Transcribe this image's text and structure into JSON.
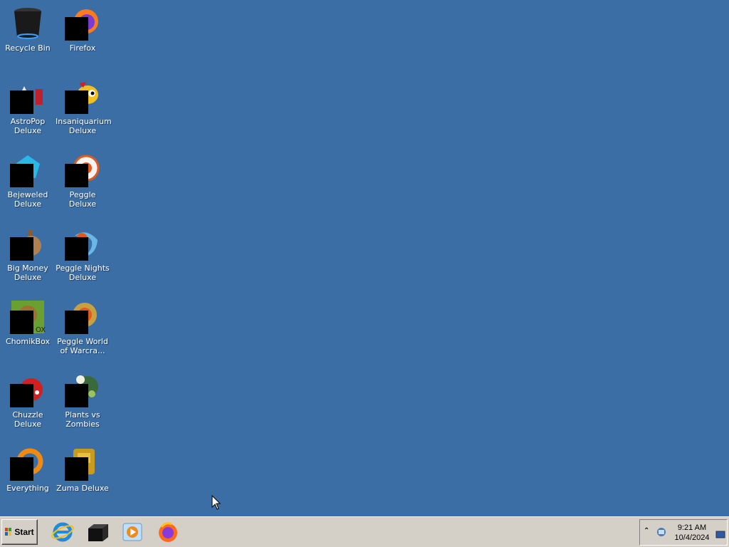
{
  "desktop": {
    "background": "#3c6ea6",
    "icons": [
      {
        "label": "Recycle Bin",
        "icon": "recycle-bin-icon"
      },
      {
        "label": "Firefox",
        "icon": "firefox-icon"
      },
      {
        "label": "AstroPop Deluxe",
        "icon": "astropop-icon"
      },
      {
        "label": "Insaniquarium Deluxe",
        "icon": "insaniquarium-icon"
      },
      {
        "label": "Bejeweled Deluxe",
        "icon": "bejeweled-icon"
      },
      {
        "label": "Peggle Deluxe",
        "icon": "peggle-icon"
      },
      {
        "label": "Big Money Deluxe",
        "icon": "big-money-icon"
      },
      {
        "label": "Peggle Nights Deluxe",
        "icon": "peggle-nights-icon"
      },
      {
        "label": "ChomikBox",
        "icon": "chomikbox-icon"
      },
      {
        "label": "Peggle World of Warcra...",
        "icon": "peggle-wow-icon"
      },
      {
        "label": "Chuzzle Deluxe",
        "icon": "chuzzle-icon"
      },
      {
        "label": "Plants vs Zombies",
        "icon": "plants-vs-zombies-icon"
      },
      {
        "label": "Everything",
        "icon": "everything-icon"
      },
      {
        "label": "Zuma Deluxe",
        "icon": "zuma-icon"
      }
    ]
  },
  "taskbar": {
    "start_label": "Start",
    "quick_launch": [
      "internet-explorer-icon",
      "show-desktop-icon",
      "media-player-icon",
      "firefox-icon"
    ],
    "tray": {
      "time": "9:21 AM",
      "date": "10/4/2024"
    }
  }
}
